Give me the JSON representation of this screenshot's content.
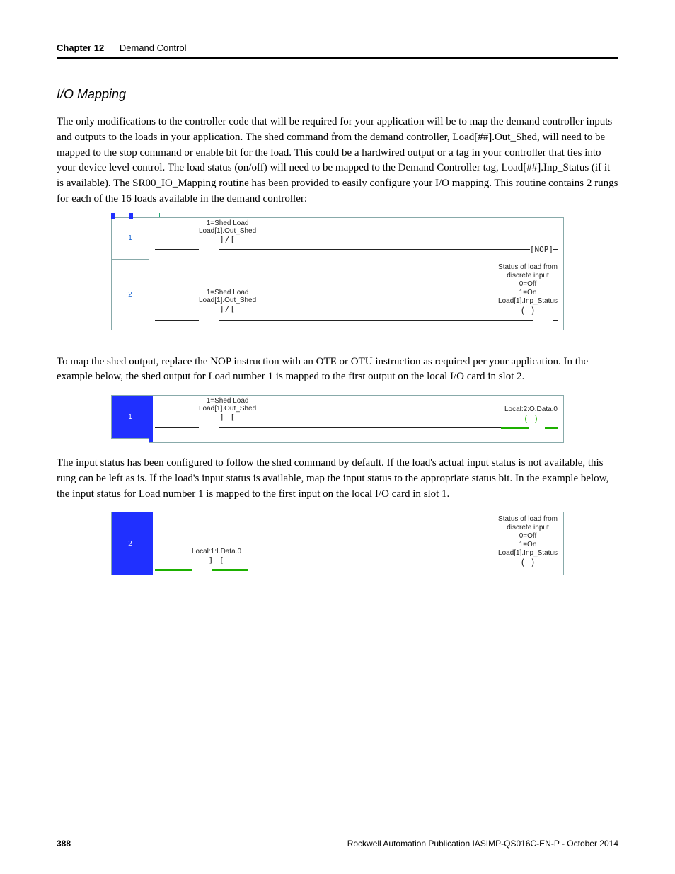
{
  "header": {
    "chapter": "Chapter 12",
    "title": "Demand Control"
  },
  "section_title": "I/O Mapping",
  "para1": "The only modifications to the controller code that will be required for your application will be to map the demand controller inputs and outputs to the loads in your application. The shed command from the demand controller, Load[##].Out_Shed, will need to be mapped to the stop command or enable bit for the load. This could be a hardwired output or a tag in your controller that ties into your device level control. The load status (on/off) will need to be mapped to the Demand Controller tag, Load[##].Inp_Status (if it is available). The SR00_IO_Mapping routine has been provided to easily configure your I/O mapping. This routine contains 2 rungs for each of the 16 loads available in the demand controller:",
  "para2": "To map the shed output, replace the NOP instruction with an OTE or OTU instruction as required per your application. In the example below, the shed output for Load number 1 is mapped to the first output on the local I/O card in slot 2.",
  "para3": "The input status has been configured to follow the shed command by default. If the load's actual input status is not available, this rung can be left as is. If the load's input status is available, map the input status to the appropriate status bit. In the example below, the input status for Load number 1 is mapped to the first input on the local I/O card in slot 1.",
  "fig1": {
    "rung1": {
      "num": "1",
      "comment": "1=Shed Load",
      "tag": "Load[1].Out_Shed",
      "right": "[NOP]"
    },
    "rung2": {
      "num": "2",
      "comment": "1=Shed Load",
      "tag": "Load[1].Out_Shed",
      "status_lines": [
        "Status of load from",
        "discrete input",
        "0=Off",
        "1=On"
      ],
      "out_tag": "Load[1].Inp_Status"
    }
  },
  "fig2": {
    "rung": {
      "num": "1",
      "comment": "1=Shed Load",
      "tag": "Load[1].Out_Shed",
      "out_tag": "Local:2:O.Data.0"
    }
  },
  "fig3": {
    "rung": {
      "num": "2",
      "tag": "Local:1:I.Data.0",
      "status_lines": [
        "Status of load from",
        "discrete input",
        "0=Off",
        "1=On"
      ],
      "out_tag": "Load[1].Inp_Status"
    }
  },
  "footer": {
    "page": "388",
    "pub": "Rockwell Automation Publication IASIMP-QS016C-EN-P - October 2014"
  }
}
